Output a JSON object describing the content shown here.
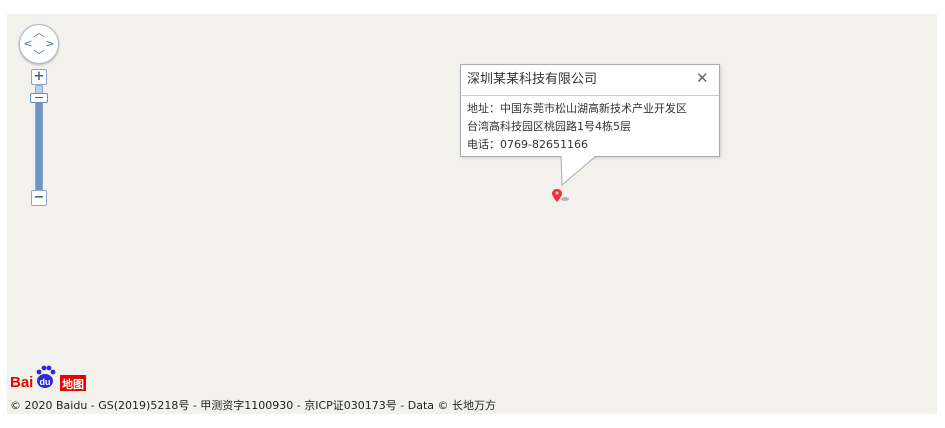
{
  "map": {
    "background_color": "#f2f1ec",
    "zoom_level_fraction": 0.0
  },
  "controls": {
    "pan_icon": "pan-arrows-icon",
    "zoom_in_label": "+",
    "zoom_out_label": "−"
  },
  "info_window": {
    "title": "深圳某某科技有限公司",
    "close_label": "✕",
    "address_line1": "地址：中国东莞市松山湖高新技术产业开发区",
    "address_line2": "台湾高科技园区桃园路1号4栋5层",
    "phone": "电话：0769-82651166"
  },
  "marker": {
    "icon": "map-pin-icon",
    "color": "#e8323c"
  },
  "logo": {
    "brand_text": "Baidu地图",
    "brand_color": "#e10602",
    "accent_color": "#2d2ad6"
  },
  "footer": {
    "copyright": "© 2020 Baidu - GS(2019)5218号 - 甲测资字1100930 - 京ICP证030173号 - Data © 长地万方"
  }
}
